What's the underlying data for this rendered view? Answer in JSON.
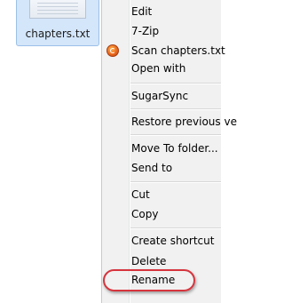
{
  "desktop": {
    "file": {
      "name": "chapters.txt",
      "icon": "text-document-icon"
    }
  },
  "context_menu": {
    "items": [
      {
        "label": "Edit"
      },
      {
        "label": "7-Zip"
      },
      {
        "label": "Scan chapters.txt",
        "icon": "antivirus-scan-icon"
      },
      {
        "label": "Open with"
      },
      {
        "label": "SugarSync"
      },
      {
        "label": "Restore previous ve"
      },
      {
        "label": "Move To folder..."
      },
      {
        "label": "Send to"
      },
      {
        "label": "Cut"
      },
      {
        "label": "Copy"
      },
      {
        "label": "Create shortcut"
      },
      {
        "label": "Delete"
      },
      {
        "label": "Rename"
      }
    ]
  },
  "annotation": {
    "highlighted_item": "Rename",
    "color": "#d6343d"
  }
}
